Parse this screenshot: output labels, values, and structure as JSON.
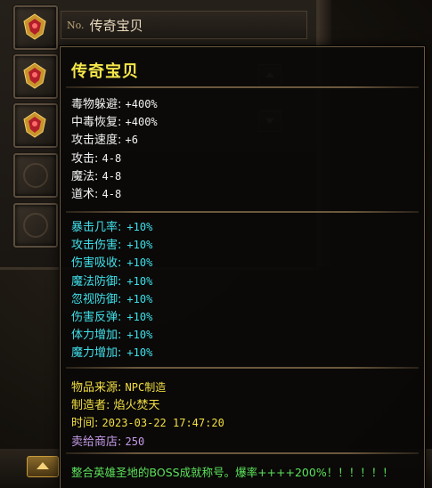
{
  "item_list": {
    "selected_no_label": "No.",
    "selected_name": "传奇宝贝",
    "slots": [
      {
        "icon": "gem-icon"
      },
      {
        "icon": "gem-icon"
      },
      {
        "icon": "gem-icon"
      },
      {
        "icon": "empty-slot-icon"
      },
      {
        "icon": "empty-slot-icon"
      }
    ]
  },
  "tooltip": {
    "title": "传奇宝贝",
    "base_stats": [
      {
        "label": "毒物躲避:",
        "value": "+400%"
      },
      {
        "label": "中毒恢复:",
        "value": "+400%"
      },
      {
        "label": "攻击速度:",
        "value": "+6"
      },
      {
        "label": "攻击:",
        "value": "4-8"
      },
      {
        "label": "魔法:",
        "value": "4-8"
      },
      {
        "label": "道术:",
        "value": "4-8"
      }
    ],
    "bonus_stats": [
      {
        "label": "暴击几率:",
        "value": "+10%"
      },
      {
        "label": "攻击伤害:",
        "value": "+10%"
      },
      {
        "label": "伤害吸收:",
        "value": "+10%"
      },
      {
        "label": "魔法防御:",
        "value": "+10%"
      },
      {
        "label": "忽视防御:",
        "value": "+10%"
      },
      {
        "label": "伤害反弹:",
        "value": "+10%"
      },
      {
        "label": "体力增加:",
        "value": "+10%"
      },
      {
        "label": "魔力增加:",
        "value": "+10%"
      }
    ],
    "source_label": "物品来源:",
    "source_value": "NPC制造",
    "maker_label": "制造者:",
    "maker_value": "焰火焚天",
    "time_label": "时间:",
    "time_value": "2023-03-22 17:47:20",
    "sell_label": "卖给商店:",
    "sell_value": "250",
    "footer_note": "整合英雄圣地的BOSS成就称号。爆率++++200%！！！！！！"
  },
  "colors": {
    "title": "#f4e64a",
    "base_stat": "#f2f2f2",
    "bonus_stat": "#3fe0ea",
    "info": "#f3df43",
    "sell": "#c69ae8",
    "footer": "#5be25b"
  }
}
